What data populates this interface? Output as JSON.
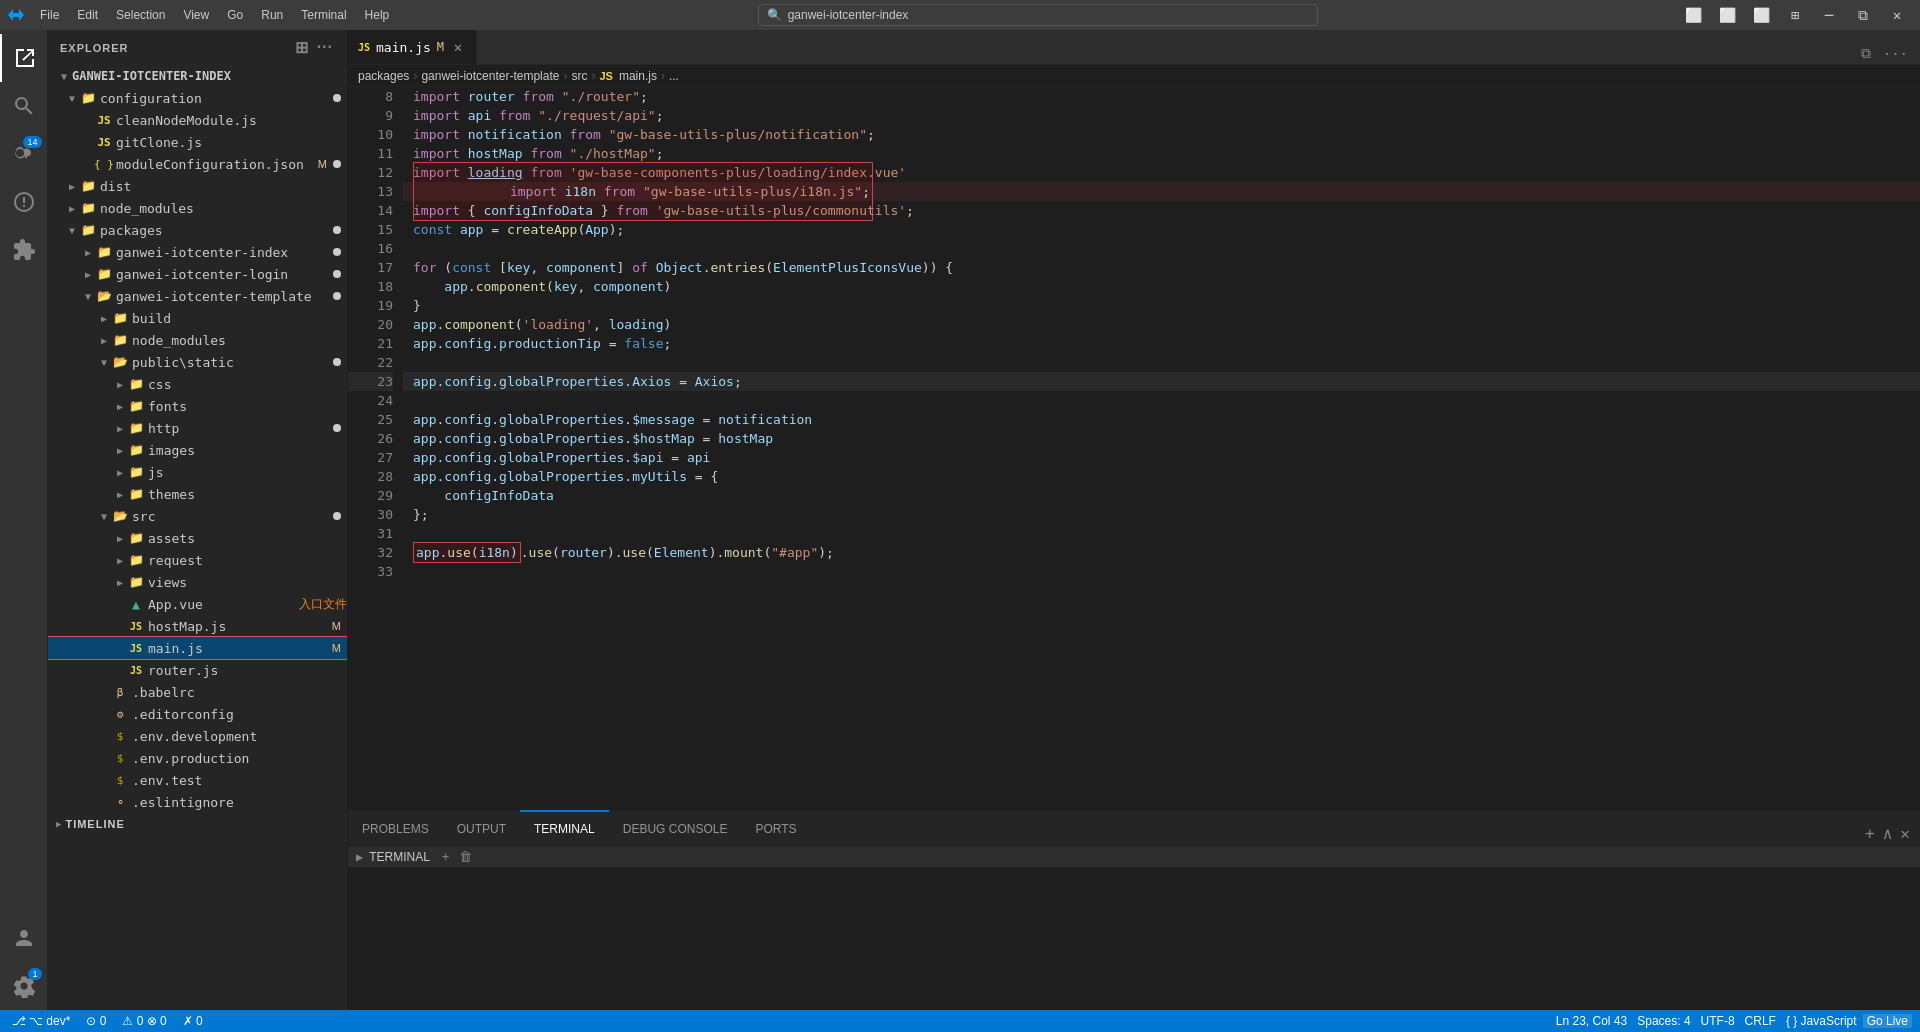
{
  "titlebar": {
    "icon": "⌨",
    "menus": [
      "File",
      "Edit",
      "Selection",
      "View",
      "Go",
      "Run",
      "Terminal",
      "Help"
    ],
    "search_text": "ganwei-iotcenter-index",
    "window_controls": [
      "minimize",
      "restore",
      "maximize",
      "tileright",
      "close"
    ]
  },
  "activity_bar": {
    "items": [
      {
        "name": "explorer",
        "icon": "files",
        "active": true
      },
      {
        "name": "search",
        "icon": "search"
      },
      {
        "name": "source-control",
        "icon": "source-control",
        "badge": "14"
      },
      {
        "name": "run-debug",
        "icon": "debug"
      },
      {
        "name": "extensions",
        "icon": "extensions"
      }
    ],
    "bottom": [
      {
        "name": "accounts",
        "icon": "account"
      },
      {
        "name": "settings",
        "icon": "settings",
        "badge": "1"
      }
    ]
  },
  "sidebar": {
    "title": "EXPLORER",
    "root": "GANWEI-IOTCENTER-INDEX",
    "tree": [
      {
        "id": "configuration",
        "label": "configuration",
        "type": "folder",
        "level": 1,
        "expanded": true,
        "dot": true,
        "dot_color": "#cccccc"
      },
      {
        "id": "cleanNodeModule",
        "label": "cleanNodeModule.js",
        "type": "js",
        "level": 2
      },
      {
        "id": "gitClone",
        "label": "gitClone.js",
        "type": "js",
        "level": 2
      },
      {
        "id": "moduleConfiguration",
        "label": "moduleConfiguration.json",
        "type": "json",
        "level": 2,
        "badge": "M",
        "dot": true
      },
      {
        "id": "dist",
        "label": "dist",
        "type": "folder",
        "level": 1,
        "dot": false
      },
      {
        "id": "node_modules",
        "label": "node_modules",
        "type": "folder",
        "level": 1
      },
      {
        "id": "packages",
        "label": "packages",
        "type": "folder",
        "level": 1,
        "expanded": true,
        "dot": true
      },
      {
        "id": "ganwei-iotcenter-index",
        "label": "ganwei-iotcenter-index",
        "type": "folder",
        "level": 2,
        "dot": true
      },
      {
        "id": "ganwei-iotcenter-login",
        "label": "ganwei-iotcenter-login",
        "type": "folder",
        "level": 2,
        "dot": true
      },
      {
        "id": "ganwei-iotcenter-template",
        "label": "ganwei-iotcenter-template",
        "type": "folder",
        "level": 2,
        "expanded": true,
        "dot": true
      },
      {
        "id": "build",
        "label": "build",
        "type": "folder",
        "level": 3
      },
      {
        "id": "node_modules2",
        "label": "node_modules",
        "type": "folder",
        "level": 3
      },
      {
        "id": "public_static",
        "label": "public\\static",
        "type": "folder",
        "level": 3,
        "expanded": true,
        "dot": true
      },
      {
        "id": "css",
        "label": "css",
        "type": "folder",
        "level": 4
      },
      {
        "id": "fonts",
        "label": "fonts",
        "type": "folder",
        "level": 4
      },
      {
        "id": "http",
        "label": "http",
        "type": "folder",
        "level": 4,
        "dot": true
      },
      {
        "id": "images",
        "label": "images",
        "type": "folder",
        "level": 4
      },
      {
        "id": "js",
        "label": "js",
        "type": "folder",
        "level": 4
      },
      {
        "id": "themes",
        "label": "themes",
        "type": "folder",
        "level": 4
      },
      {
        "id": "src",
        "label": "src",
        "type": "folder",
        "level": 3,
        "expanded": true,
        "dot": true
      },
      {
        "id": "assets",
        "label": "assets",
        "type": "folder",
        "level": 4
      },
      {
        "id": "request",
        "label": "request",
        "type": "folder",
        "level": 4
      },
      {
        "id": "views",
        "label": "views",
        "type": "folder",
        "level": 4
      },
      {
        "id": "App.vue",
        "label": "App.vue",
        "type": "vue",
        "level": 4,
        "annotation": "入口文件"
      },
      {
        "id": "hostMap.js",
        "label": "hostMap.js",
        "type": "js",
        "level": 4,
        "badge": "M"
      },
      {
        "id": "main.js",
        "label": "main.js",
        "type": "js",
        "level": 4,
        "badge": "M",
        "selected": true
      },
      {
        "id": "router.js",
        "label": "router.js",
        "type": "js",
        "level": 4
      },
      {
        "id": "babelrc",
        "label": ".babelrc",
        "type": "dot",
        "level": 3
      },
      {
        "id": "editorconfig",
        "label": ".editorconfig",
        "type": "dot",
        "level": 3
      },
      {
        "id": "env.development",
        "label": ".env.development",
        "type": "env",
        "level": 3
      },
      {
        "id": "env.production",
        "label": ".env.production",
        "type": "env",
        "level": 3
      },
      {
        "id": "env.test",
        "label": ".env.test",
        "type": "env",
        "level": 3
      },
      {
        "id": "eslintignore",
        "label": ".eslintignore",
        "type": "dot",
        "level": 3
      }
    ],
    "timeline": "TIMELINE"
  },
  "editor": {
    "tabs": [
      {
        "id": "main.js",
        "label": "main.js",
        "type": "js",
        "modified": true,
        "active": true
      }
    ],
    "breadcrumb": [
      "packages",
      "ganwei-iotcenter-template",
      "src",
      "main.js",
      "..."
    ],
    "lines": [
      {
        "num": 8,
        "content": "import_router",
        "raw": "import <var>router</var> from <str>\"./router\"</str>;"
      },
      {
        "num": 9,
        "raw": "import <var>api</var> from <str>\"./request/api\"</str>;"
      },
      {
        "num": 10,
        "raw": "import <var>notification</var> from <str>\"gw-base-utils-plus/notification\"</str>;"
      },
      {
        "num": 11,
        "raw": "import <var>hostMap</var> from <str>\"./hostMap\"</str>;"
      },
      {
        "num": 12,
        "raw": "import <u>loading</u> from <str>'gw-base-components-plus/loading/index.vue'</str>"
      },
      {
        "num": 13,
        "raw": "import <var>i18n</var> from <str>\"gw-base-utils-plus/i18n.js\"</str>;",
        "highlight": "red"
      },
      {
        "num": 14,
        "raw": "import <punct>{ <var>configInfoData</var> }</punct> from <str>'gw-base-utils-plus/commonutils'</str>;"
      },
      {
        "num": 15,
        "raw": "const <var>app</var> = <fn>createApp</fn>(<var>App</var>);"
      },
      {
        "num": 16,
        "raw": ""
      },
      {
        "num": 17,
        "raw": "for <punct>(</punct>const <punct>[</punct><var>key</var>, <var>component</var><punct>]</punct> of <var>Object</var>.<fn>entries</fn>(<var>ElementPlusIconsVue</var>)<punct>) {</punct>"
      },
      {
        "num": 18,
        "raw": "    <var>app</var>.<fn>component</fn>(<var>key</var>, <var>component</var>)"
      },
      {
        "num": 19,
        "raw": "}"
      },
      {
        "num": 20,
        "raw": "<var>app</var>.<fn>component</fn>(<str>'loading'</str>, <var>loading</var>)"
      },
      {
        "num": 21,
        "raw": "<var>app</var>.<var>config</var>.<var>productionTip</var> = <kw>false</kw>;"
      },
      {
        "num": 22,
        "raw": ""
      },
      {
        "num": 23,
        "raw": "<var>app</var>.<var>config</var>.<var>globalProperties</var>.<var>Axios</var> = <var>Axios</var>;",
        "cursor": true
      },
      {
        "num": 24,
        "raw": ""
      },
      {
        "num": 25,
        "raw": "<var>app</var>.<var>config</var>.<var>globalProperties</var>.<var>$message</var> = <var>notification</var>"
      },
      {
        "num": 26,
        "raw": "<var>app</var>.<var>config</var>.<var>globalProperties</var>.<var>$hostMap</var> = <var>hostMap</var>"
      },
      {
        "num": 27,
        "raw": "<var>app</var>.<var>config</var>.<var>globalProperties</var>.<var>$api</var> = <var>api</var>"
      },
      {
        "num": 28,
        "raw": "<var>app</var>.<var>config</var>.<var>globalProperties</var>.<var>myUtils</var> = <punct>{</punct>"
      },
      {
        "num": 29,
        "raw": "    <var>configInfoData</var>"
      },
      {
        "num": 30,
        "raw": "};"
      },
      {
        "num": 31,
        "raw": ""
      },
      {
        "num": 32,
        "raw": "<var>app</var>.<fn>use</fn>(<var>i18n</var>).<fn>use</fn>(<var>router</var>).<fn>use</fn>(<var>Element</var>).<fn>mount</fn>(<str>\"#app\"</str>);",
        "highlight32": true
      },
      {
        "num": 33,
        "raw": ""
      }
    ]
  },
  "terminal": {
    "tabs": [
      "PROBLEMS",
      "OUTPUT",
      "TERMINAL",
      "DEBUG CONSOLE",
      "PORTS"
    ],
    "active_tab": "TERMINAL",
    "header_label": "TERMINAL",
    "content": []
  },
  "statusbar": {
    "left": [
      {
        "label": "⌥ dev*",
        "icon": "git"
      },
      {
        "label": "⊙ 0",
        "icon": "sync"
      },
      {
        "label": "⚠ 0 ⊗ 0",
        "icon": "warning"
      },
      {
        "label": "✗ 0",
        "icon": "error"
      }
    ],
    "right": [
      {
        "label": "Ln 23, Col 43"
      },
      {
        "label": "Spaces: 4"
      },
      {
        "label": "UTF-8"
      },
      {
        "label": "CRLF"
      },
      {
        "label": "{ } JavaScript"
      },
      {
        "label": "Go Live"
      }
    ]
  }
}
